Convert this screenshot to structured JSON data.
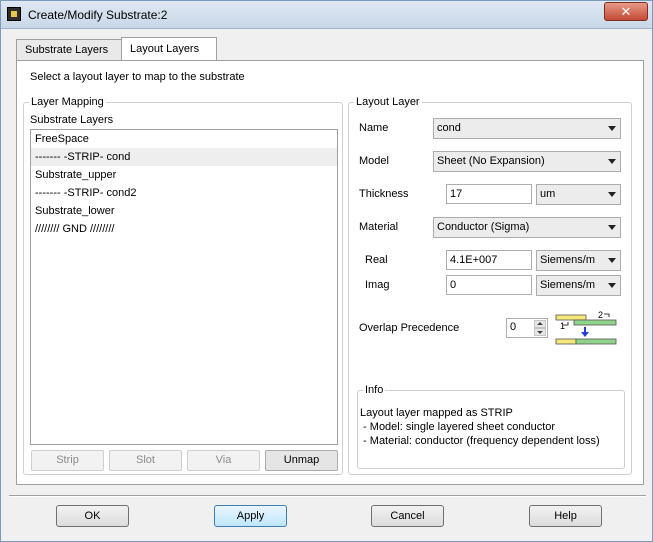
{
  "window": {
    "title": "Create/Modify Substrate:2",
    "close_glyph": "✕"
  },
  "tabs": [
    {
      "label": "Substrate Layers",
      "active": false
    },
    {
      "label": "Layout Layers",
      "active": true
    }
  ],
  "instruction": "Select a layout layer to map to the substrate",
  "layer_mapping": {
    "group_title": "Layer Mapping",
    "list_label": "Substrate Layers",
    "items": [
      {
        "text": "FreeSpace",
        "selected": false
      },
      {
        "text": "------- -STRIP- cond",
        "selected": true
      },
      {
        "text": "Substrate_upper",
        "selected": false
      },
      {
        "text": "------- -STRIP- cond2",
        "selected": false
      },
      {
        "text": "Substrate_lower",
        "selected": false
      },
      {
        "text": "//////// GND ////////",
        "selected": false
      }
    ],
    "buttons": {
      "strip": "Strip",
      "slot": "Slot",
      "via": "Via",
      "unmap": "Unmap"
    }
  },
  "layout_layer": {
    "group_title": "Layout Layer",
    "name_label": "Name",
    "name_value": "cond",
    "model_label": "Model",
    "model_value": "Sheet (No Expansion)",
    "thickness_label": "Thickness",
    "thickness_value": "17",
    "thickness_unit": "um",
    "material_label": "Material",
    "material_value": "Conductor (Sigma)",
    "real_label": "Real",
    "real_value": "4.1E+007",
    "real_unit": "Siemens/m",
    "imag_label": "Imag",
    "imag_value": "0",
    "imag_unit": "Siemens/m",
    "overlap_label": "Overlap Precedence",
    "overlap_value": "0",
    "overlap_diagram": {
      "label_1": "1",
      "label_2": "2"
    }
  },
  "info": {
    "title": "Info",
    "lines": [
      "Layout layer mapped as STRIP",
      " - Model: single layered sheet conductor",
      " - Material: conductor (frequency dependent loss)"
    ]
  },
  "dialog_buttons": {
    "ok": "OK",
    "apply": "Apply",
    "cancel": "Cancel",
    "help": "Help"
  },
  "colors": {
    "selection": "#eeeeee",
    "diagram_yellow": "#f5e87a",
    "diagram_green": "#8fd48a",
    "diagram_arrow": "#1f3fd6"
  }
}
